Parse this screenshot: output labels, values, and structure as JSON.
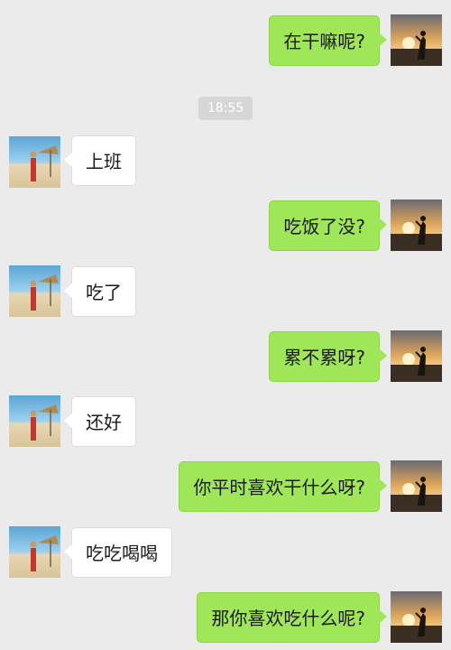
{
  "chat": {
    "timestamp": "18:55",
    "messages": [
      {
        "side": "me",
        "text": "在干嘛呢?"
      },
      {
        "side": "other",
        "text": "上班"
      },
      {
        "side": "me",
        "text": "吃饭了没?"
      },
      {
        "side": "other",
        "text": "吃了"
      },
      {
        "side": "me",
        "text": "累不累呀?"
      },
      {
        "side": "other",
        "text": "还好"
      },
      {
        "side": "me",
        "text": "你平时喜欢干什么呀?"
      },
      {
        "side": "other",
        "text": "吃吃喝喝"
      },
      {
        "side": "me",
        "text": "那你喜欢吃什么呢?"
      }
    ]
  },
  "avatars": {
    "me": "sunset-couple-avatar",
    "other": "beach-girl-avatar"
  },
  "colors": {
    "background": "#ebebeb",
    "my_bubble": "#9fe658",
    "other_bubble": "#ffffff",
    "timestamp_bg": "#d6d6d6"
  }
}
